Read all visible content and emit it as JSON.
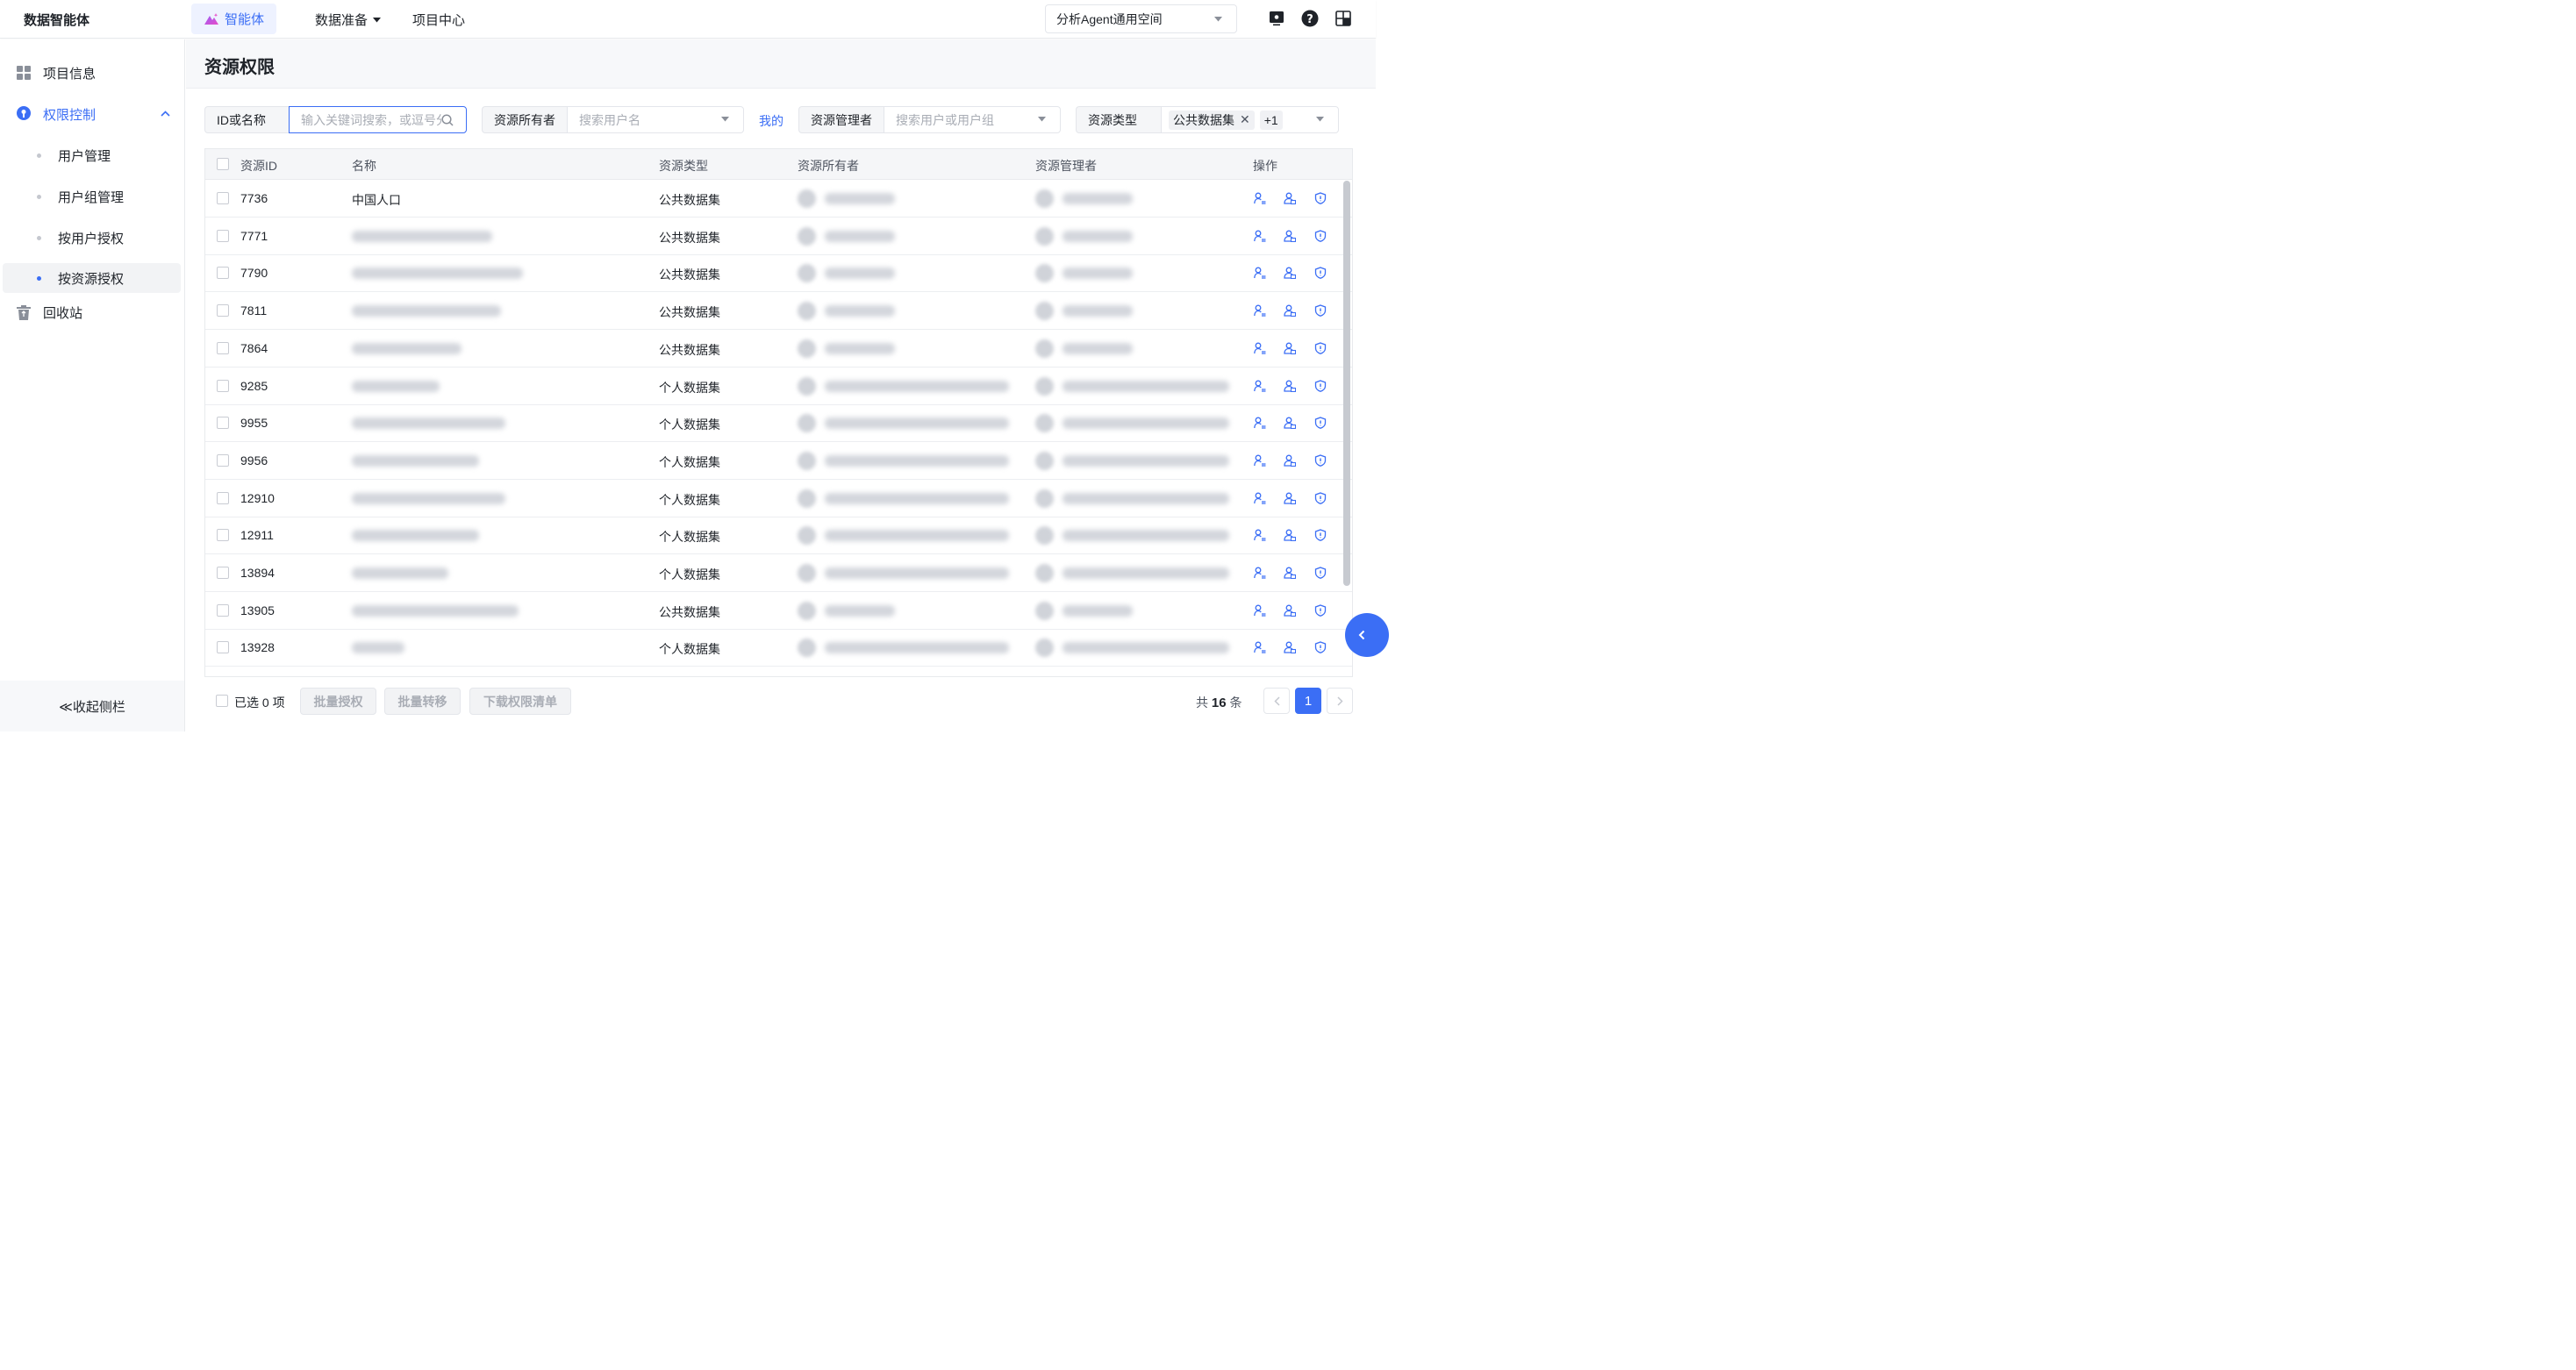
{
  "header": {
    "app_title": "数据智能体",
    "nav": [
      {
        "label": "智能体",
        "active": true
      },
      {
        "label": "数据准备",
        "has_dropdown": true
      },
      {
        "label": "项目中心"
      }
    ],
    "space_select": "分析Agent通用空间",
    "icons": [
      "screen-icon",
      "help-icon",
      "layout-icon"
    ]
  },
  "sidebar": {
    "items": [
      {
        "label": "项目信息",
        "icon": "grid-icon"
      },
      {
        "label": "权限控制",
        "icon": "pin-icon",
        "expanded": true
      },
      {
        "label": "回收站",
        "icon": "trash-icon"
      }
    ],
    "subitems": [
      {
        "label": "用户管理"
      },
      {
        "label": "用户组管理"
      },
      {
        "label": "按用户授权"
      },
      {
        "label": "按资源授权",
        "active": true
      }
    ],
    "collapse_label": "≪收起侧栏"
  },
  "main": {
    "page_title": "资源权限",
    "filters": {
      "id_name_label": "ID或名称",
      "id_name_placeholder": "输入关键词搜索，或逗号分",
      "owner_label": "资源所有者",
      "owner_placeholder": "搜索用户名",
      "my_link": "我的",
      "manager_label": "资源管理者",
      "manager_placeholder": "搜索用户或用户组",
      "type_label": "资源类型",
      "type_tag": "公共数据集",
      "type_more": "+1"
    },
    "table": {
      "columns": [
        "资源ID",
        "名称",
        "资源类型",
        "资源所有者",
        "资源管理者",
        "操作"
      ],
      "rows": [
        {
          "id": "7736",
          "name": "中国人口",
          "type": "公共数据集"
        },
        {
          "id": "7771",
          "name": "",
          "type": "公共数据集"
        },
        {
          "id": "7790",
          "name": "",
          "type": "公共数据集"
        },
        {
          "id": "7811",
          "name": "",
          "type": "公共数据集"
        },
        {
          "id": "7864",
          "name": "",
          "type": "公共数据集"
        },
        {
          "id": "9285",
          "name": "",
          "type": "个人数据集"
        },
        {
          "id": "9955",
          "name": "",
          "type": "个人数据集"
        },
        {
          "id": "9956",
          "name": "",
          "type": "个人数据集"
        },
        {
          "id": "12910",
          "name": "",
          "type": "个人数据集"
        },
        {
          "id": "12911",
          "name": "",
          "type": "个人数据集"
        },
        {
          "id": "13894",
          "name": "",
          "type": "个人数据集"
        },
        {
          "id": "13905",
          "name": "",
          "type": "公共数据集"
        },
        {
          "id": "13928",
          "name": "",
          "type": "个人数据集"
        }
      ],
      "row_actions": [
        "user-edit-icon",
        "user-group-icon",
        "shield-icon"
      ]
    },
    "footer": {
      "selected": "已选 0 项",
      "batch_grant": "批量授权",
      "batch_transfer": "批量转移",
      "download": "下载权限清单",
      "total_prefix": "共",
      "total_count": "16",
      "total_suffix": "条",
      "current_page": "1"
    }
  },
  "colors": {
    "accent": "#3b6ef5",
    "text": "#1f2329",
    "muted": "#a9adb5",
    "header_bg": "#f7f8fa"
  }
}
